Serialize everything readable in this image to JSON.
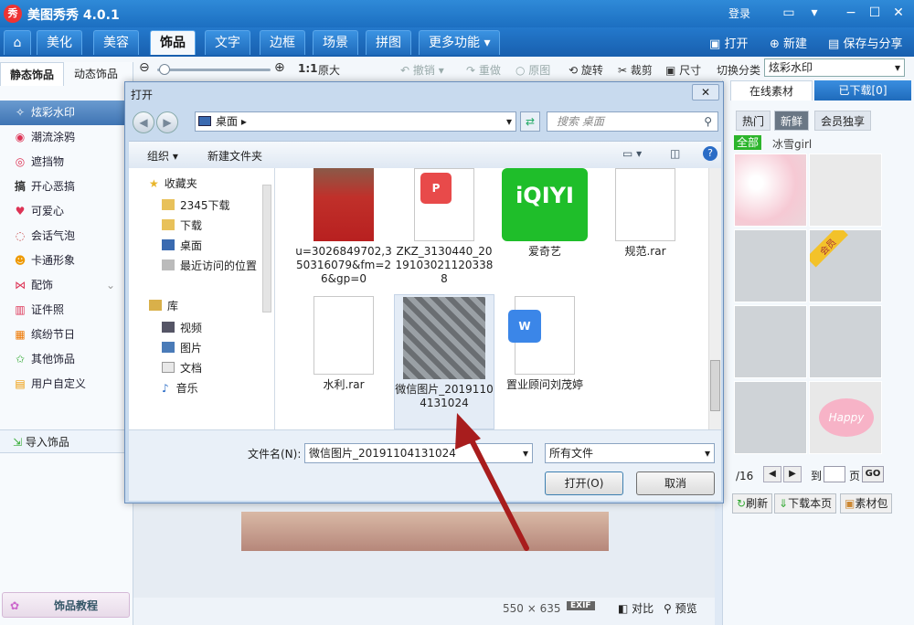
{
  "app": {
    "title": "美图秀秀 4.0.1",
    "login": "登录",
    "logo": "秀"
  },
  "nav": {
    "tabs": [
      "美化",
      "美容",
      "饰品",
      "文字",
      "边框",
      "场景",
      "拼图",
      "更多功能"
    ],
    "open": "打开",
    "new": "新建",
    "save_share": "保存与分享"
  },
  "toolbar": {
    "actual_size": "1:1",
    "original_size": "原大",
    "undo": "撤销",
    "redo": "重做",
    "original": "原图",
    "rotate": "旋转",
    "crop": "裁剪",
    "resize": "尺寸",
    "switch_category": "切换分类",
    "category_value": "炫彩水印"
  },
  "left": {
    "tabs": [
      "静态饰品",
      "动态饰品"
    ],
    "items": [
      "炫彩水印",
      "潮流涂鸦",
      "遮挡物",
      "开心恶搞",
      "可爱心",
      "会话气泡",
      "卡通形象",
      "配饰",
      "证件照",
      "缤纷节日",
      "其他饰品",
      "用户自定义"
    ],
    "import": "导入饰品",
    "tutorial": "饰品教程"
  },
  "right": {
    "tabs": [
      "在线素材",
      "已下载[0]"
    ],
    "filters": [
      "热门",
      "新鲜",
      "会员独享"
    ],
    "sub": [
      "全部",
      "冰雪girl"
    ],
    "vip_badge": "会员",
    "happy_text": "Happy",
    "pager_text": "/16",
    "goto": "到",
    "page": "页",
    "go": "GO",
    "refresh": "刷新",
    "download_page": "下载本页",
    "pack": "素材包"
  },
  "status": {
    "size": "550 × 635",
    "exif": "EXIF",
    "compare": "对比",
    "preview": "预览"
  },
  "dialog": {
    "title": "打开",
    "address": "桌面",
    "search_placeholder": "搜索 桌面",
    "organize": "组织",
    "new_folder": "新建文件夹",
    "nav": {
      "favorites": "收藏夹",
      "fav_items": [
        "2345下载",
        "下载",
        "桌面",
        "最近访问的位置"
      ],
      "library": "库",
      "lib_items": [
        "视频",
        "图片",
        "文档",
        "音乐"
      ]
    },
    "files": [
      {
        "name": "u=3026849702,350316079&fm=26&gp=0"
      },
      {
        "name": "ZKZ_3130440_20191030211203388"
      },
      {
        "name": "爱奇艺"
      },
      {
        "name": "规范.rar"
      },
      {
        "name": "水利.rar"
      },
      {
        "name": "微信图片_20191104131024"
      },
      {
        "name": "置业顾问刘茂婷"
      }
    ],
    "filename_label": "文件名(N):",
    "filename_value": "微信图片_20191104131024",
    "filetype_value": "所有文件",
    "open_btn": "打开(O)",
    "cancel_btn": "取消",
    "iqiyi_logo": "iQIYI"
  },
  "colors": {
    "accent": "#1c6fc1",
    "active_item": "#3f74b3",
    "arrow": "#a81d1d",
    "iqiyi": "#00be06"
  }
}
